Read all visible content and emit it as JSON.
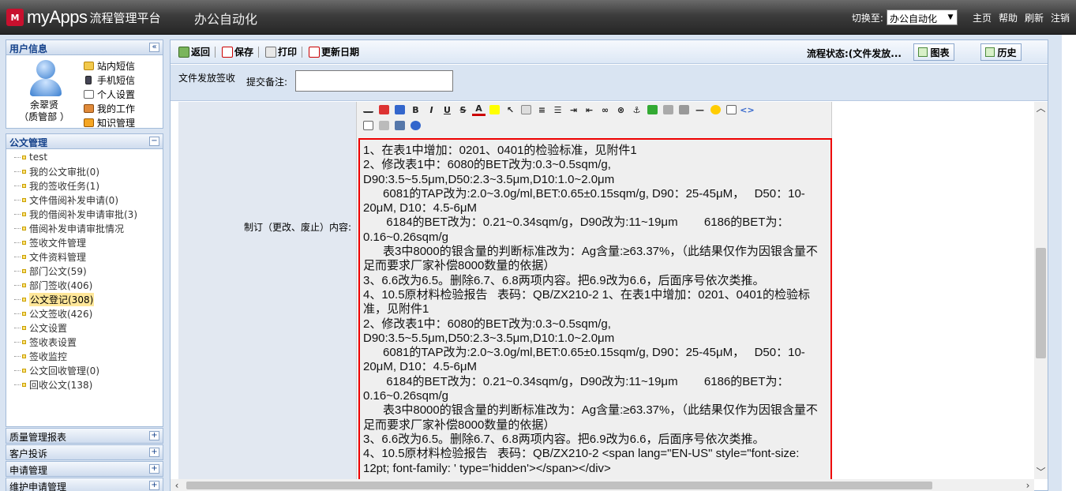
{
  "header": {
    "logo_icon_text": "M",
    "logo_name": "myApps",
    "logo_sub": "流程管理平台",
    "module_title": "办公自动化",
    "switch_label": "切换至:",
    "switch_value": "办公自动化",
    "links": [
      "主页",
      "帮助",
      "刷新",
      "注销"
    ]
  },
  "user_panel": {
    "title": "用户信息",
    "name": "余翠贤",
    "dept": "（质管部 ）",
    "links": [
      "站内短信",
      "手机短信",
      "个人设置",
      "我的工作",
      "知识管理"
    ]
  },
  "doc_panel": {
    "title": "公文管理",
    "items": [
      "test",
      "我的公文审批(0)",
      "我的签收任务(1)",
      "文件借阅补发申请(0)",
      "我的借阅补发申请审批(3)",
      "借阅补发申请审批情况",
      "签收文件管理",
      "文件资料管理",
      "部门公文(59)",
      "部门签收(406)",
      "公文登记(308)",
      "公文签收(426)",
      "公文设置",
      "签收表设置",
      "签收监控",
      "公文回收管理(0)",
      "回收公文(138)"
    ],
    "selected_index": 10
  },
  "collapsed_panels": [
    "质量管理报表",
    "客户投诉",
    "申请管理",
    "维护申请管理"
  ],
  "toolbar": {
    "back": "返回",
    "save": "保存",
    "print": "打印",
    "update_date": "更新日期",
    "flow_status": "流程状态:(文件发放...",
    "chart_btn": "图表",
    "history_btn": "历史"
  },
  "form": {
    "title": "文件发放签收",
    "note_label": "提交备注:",
    "note_value": "",
    "field_label": "制订（更改、废止）内容:"
  },
  "editor_content": [
    "1、在表1中增加：0201、0401的检验标准，见附件1",
    "2、修改表1中：6080的BET改为:0.3~0.5sqm/g,",
    "D90:3.5~5.5μm,D50:2.3~3.5μm,D10:1.0~2.0μm",
    "      6081的TAP改为:2.0~3.0g/ml,BET:0.65±0.15sqm/g, D90：25-45μM，   D50：10-20μM, D10：4.5-6μM",
    "       6184的BET改为：0.21~0.34sqm/g，D90改为:11~19μm        6186的BET为：0.16~0.26sqm/g",
    "      表3中8000的银含量的判断标准改为：Ag含量:≥63.37%，（此结果仅作为因银含量不足而要求厂家补偿8000数量的依据）",
    "3、6.6改为6.5。删除6.7、6.8两项内容。把6.9改为6.6，后面序号依次类推。",
    "4、10.5原材料检验报告   表码：QB/ZX210-2 1、在表1中增加：0201、0401的检验标准，见附件1",
    "2、修改表1中：6080的BET改为:0.3~0.5sqm/g,",
    "D90:3.5~5.5μm,D50:2.3~3.5μm,D10:1.0~2.0μm",
    "      6081的TAP改为:2.0~3.0g/ml,BET:0.65±0.15sqm/g, D90：25-45μM，   D50：10-20μM, D10：4.5-6μM",
    "       6184的BET改为：0.21~0.34sqm/g，D90改为:11~19μm        6186的BET为：0.16~0.26sqm/g",
    "      表3中8000的银含量的判断标准改为：Ag含量:≥63.37%，（此结果仅作为因银含量不足而要求厂家补偿8000数量的依据）",
    "3、6.6改为6.5。删除6.7、6.8两项内容。把6.9改为6.6，后面序号依次类推。",
    "4、10.5原材料检验报告   表码：QB/ZX210-2 <span lang=\"EN-US\" style=\"font-size: 12pt; font-family: ' type='hidden'></span></div>"
  ],
  "colors": {
    "accent": "#15428b",
    "panel_border": "#a3bbd9",
    "editor_highlight_border": "#ee0000",
    "selected_item_bg": "#ffe79a"
  }
}
